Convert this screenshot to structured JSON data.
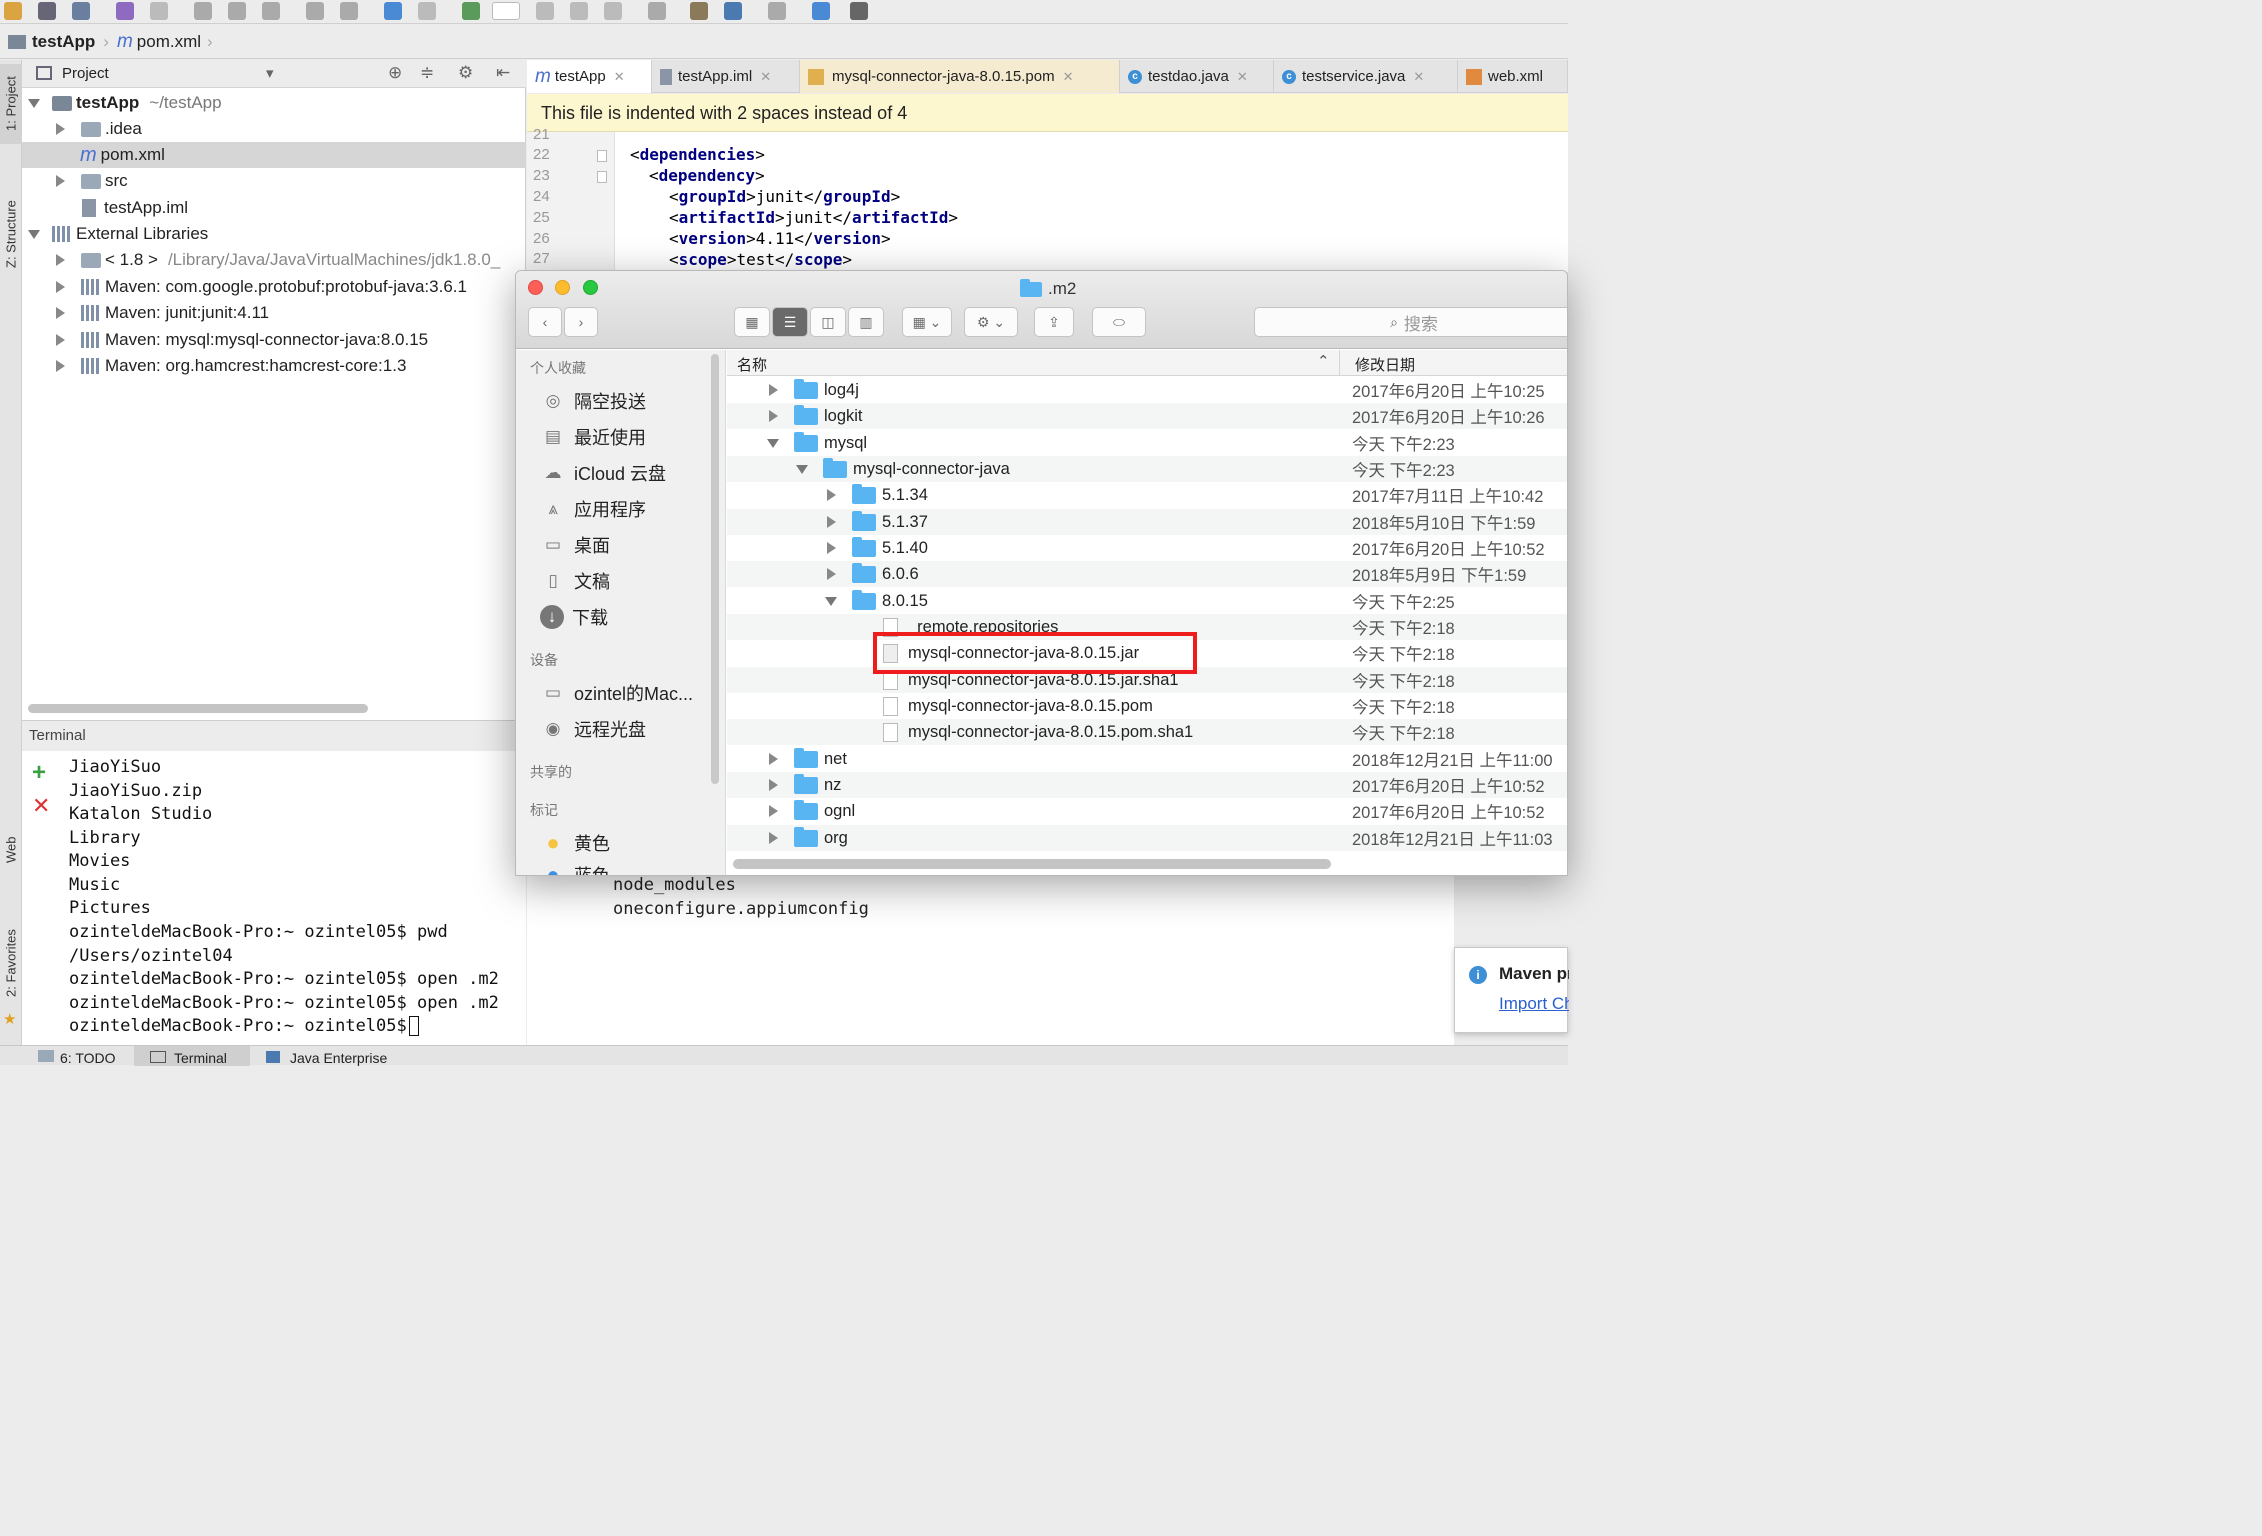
{
  "colors": {
    "tag": "#000080",
    "highlight": "#ee1c1c",
    "folder": "#59b5f2",
    "banner": "#fdf7d0"
  },
  "breadcrumb": {
    "project": "testApp",
    "file": "pom.xml"
  },
  "left_strip": {
    "project_tab": "1: Project",
    "structure_tab": "Z: Structure",
    "web_tab": "Web",
    "favorites_tab": "2: Favorites"
  },
  "project_panel": {
    "title": "Project",
    "tree": [
      {
        "label": "testApp",
        "suffix": "~/testApp"
      },
      {
        "label": ".idea"
      },
      {
        "label": "pom.xml"
      },
      {
        "label": "src"
      },
      {
        "label": "testApp.iml"
      },
      {
        "label": "External Libraries"
      },
      {
        "label": "< 1.8 >",
        "suffix": "/Library/Java/JavaVirtualMachines/jdk1.8.0_"
      },
      {
        "label": "Maven: com.google.protobuf:protobuf-java:3.6.1"
      },
      {
        "label": "Maven: junit:junit:4.11"
      },
      {
        "label": "Maven: mysql:mysql-connector-java:8.0.15"
      },
      {
        "label": "Maven: org.hamcrest:hamcrest-core:1.3"
      }
    ]
  },
  "terminal": {
    "title": "Terminal",
    "lines": [
      "JiaoYiSuo",
      "JiaoYiSuo.zip",
      "Katalon Studio",
      "Library",
      "Movies",
      "Music",
      "Pictures",
      "ozinteldeMacBook-Pro:~ ozintel05$ pwd",
      "/Users/ozintel04",
      "ozinteldeMacBook-Pro:~ ozintel05$ open .m2",
      "ozinteldeMacBook-Pro:~ ozintel05$ open .m2",
      "ozinteldeMacBook-Pro:~ ozintel05$"
    ],
    "lines_behind": [
      "node_modules",
      "oneconfigure.appiumconfig"
    ]
  },
  "editor": {
    "tabs": [
      "testApp",
      "testApp.iml",
      "mysql-connector-java-8.0.15.pom",
      "testdao.java",
      "testservice.java",
      "web.xml"
    ],
    "banner": "This file is indented with 2 spaces instead of 4",
    "line_numbers": [
      "21",
      "22",
      "23",
      "24",
      "25",
      "26",
      "27"
    ],
    "code": [
      {
        "open": "dependencies",
        "text": "",
        "close": ""
      },
      {
        "open": "dependency",
        "text": "",
        "close": ""
      },
      {
        "open": "groupId",
        "text": "junit",
        "close": "groupId"
      },
      {
        "open": "artifactId",
        "text": "junit",
        "close": "artifactId"
      },
      {
        "open": "version",
        "text": "4.11",
        "close": "version"
      },
      {
        "open": "scope",
        "text": "test",
        "close": "scope"
      }
    ]
  },
  "finder": {
    "title": ".m2",
    "search_placeholder": "搜索",
    "sidebar": {
      "favorites_header": "个人收藏",
      "favorites": [
        "隔空投送",
        "最近使用",
        "iCloud 云盘",
        "应用程序",
        "桌面",
        "文稿",
        "下载"
      ],
      "devices_header": "设备",
      "devices": [
        "ozintel的Mac...",
        "远程光盘"
      ],
      "shared_header": "共享的",
      "tags_header": "标记",
      "tags": [
        "黄色",
        "蓝色"
      ]
    },
    "columns": {
      "name": "名称",
      "modified": "修改日期"
    },
    "rows": [
      {
        "name": "log4j",
        "date": "2017年6月20日 上午10:25"
      },
      {
        "name": "logkit",
        "date": "2017年6月20日 上午10:26"
      },
      {
        "name": "mysql",
        "date": "今天 下午2:23"
      },
      {
        "name": "mysql-connector-java",
        "date": "今天 下午2:23"
      },
      {
        "name": "5.1.34",
        "date": "2017年7月11日 上午10:42"
      },
      {
        "name": "5.1.37",
        "date": "2018年5月10日 下午1:59"
      },
      {
        "name": "5.1.40",
        "date": "2017年6月20日 上午10:52"
      },
      {
        "name": "6.0.6",
        "date": "2018年5月9日 下午1:59"
      },
      {
        "name": "8.0.15",
        "date": "今天 下午2:25"
      },
      {
        "name": "_remote.repositories",
        "date": "今天 下午2:18"
      },
      {
        "name": "mysql-connector-java-8.0.15.jar",
        "date": "今天 下午2:18"
      },
      {
        "name": "mysql-connector-java-8.0.15.jar.sha1",
        "date": "今天 下午2:18"
      },
      {
        "name": "mysql-connector-java-8.0.15.pom",
        "date": "今天 下午2:18"
      },
      {
        "name": "mysql-connector-java-8.0.15.pom.sha1",
        "date": "今天 下午2:18"
      },
      {
        "name": "net",
        "date": "2018年12月21日 上午11:00"
      },
      {
        "name": "nz",
        "date": "2017年6月20日 上午10:52"
      },
      {
        "name": "ognl",
        "date": "2017年6月20日 上午10:52"
      },
      {
        "name": "org",
        "date": "2018年12月21日 上午11:03"
      }
    ]
  },
  "notification": {
    "title": "Maven projects need to be imported",
    "link": "Import Changes"
  },
  "statusbar": {
    "todo": "6: TODO",
    "terminal": "Terminal",
    "javaee": "Java Enterprise"
  }
}
